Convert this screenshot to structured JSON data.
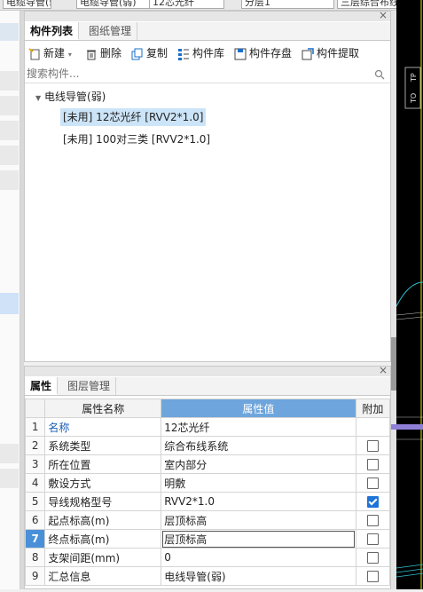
{
  "topbar": {
    "combo1": "电缆导管(弱)",
    "combo2": "12芯光纤",
    "combo3": "分层1",
    "combo4": "三层综合布线"
  },
  "panel1": {
    "close": "×",
    "tabs": [
      "构件列表",
      "图纸管理"
    ],
    "toolbar": {
      "new": "新建",
      "delete": "删除",
      "copy": "复制",
      "library": "构件库",
      "save": "构件存盘",
      "extract": "构件提取"
    },
    "search_placeholder": "搜索构件...",
    "tree": {
      "root": "电线导管(弱)",
      "items": [
        "[未用] 12芯光纤 [RVV2*1.0]",
        "[未用] 100对三类 [RVV2*1.0]"
      ]
    }
  },
  "panel2": {
    "close": "×",
    "tabs": [
      "属性",
      "图层管理"
    ],
    "headers": [
      "属性名称",
      "属性值",
      "附加"
    ],
    "rows": [
      {
        "n": "1",
        "name": "名称",
        "value": "12芯光纤",
        "check": null
      },
      {
        "n": "2",
        "name": "系统类型",
        "value": "综合布线系统",
        "check": false
      },
      {
        "n": "3",
        "name": "所在位置",
        "value": "室内部分",
        "check": false
      },
      {
        "n": "4",
        "name": "敷设方式",
        "value": "明敷",
        "check": false
      },
      {
        "n": "5",
        "name": "导线规格型号",
        "value": "RVV2*1.0",
        "check": true
      },
      {
        "n": "6",
        "name": "起点标高(m)",
        "value": "层顶标高",
        "check": false
      },
      {
        "n": "7",
        "name": "终点标高(m)",
        "value": "层顶标高",
        "check": false
      },
      {
        "n": "8",
        "name": "支架间距(mm)",
        "value": "0",
        "check": false
      },
      {
        "n": "9",
        "name": "汇总信息",
        "value": "电线导管(弱)",
        "check": false
      }
    ]
  },
  "canvas": {
    "label1": "TP",
    "label2": "TO"
  }
}
